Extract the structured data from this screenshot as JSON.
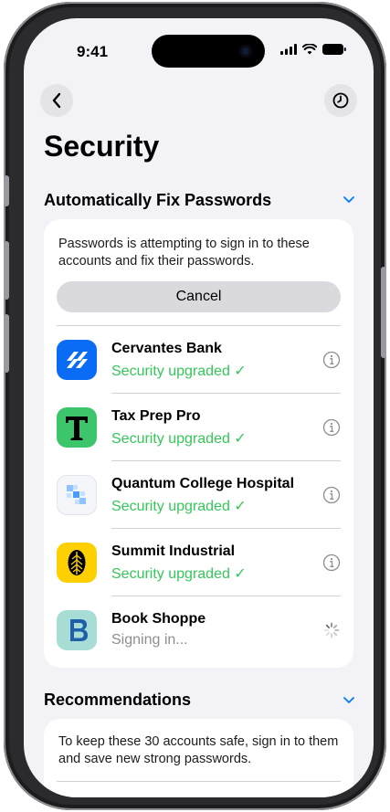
{
  "status_bar": {
    "time": "9:41"
  },
  "page": {
    "title": "Security"
  },
  "auto_fix": {
    "title": "Automatically Fix Passwords",
    "description": "Passwords is attempting to sign in to these accounts and fix their passwords.",
    "cancel_label": "Cancel",
    "accounts": [
      {
        "name": "Cervantes Bank",
        "status": "Security upgraded ✓"
      },
      {
        "name": "Tax Prep Pro",
        "status": "Security upgraded ✓"
      },
      {
        "name": "Quantum College Hospital",
        "status": "Security upgraded ✓"
      },
      {
        "name": "Summit Industrial",
        "status": "Security upgraded ✓"
      },
      {
        "name": "Book Shoppe",
        "status": "Signing in..."
      }
    ]
  },
  "recommendations": {
    "title": "Recommendations",
    "description": "To keep these 30 accounts safe, sign in to them and save new strong passwords."
  },
  "colors": {
    "success": "#34c759",
    "accent": "#007aff",
    "background": "#f2f2f7"
  }
}
